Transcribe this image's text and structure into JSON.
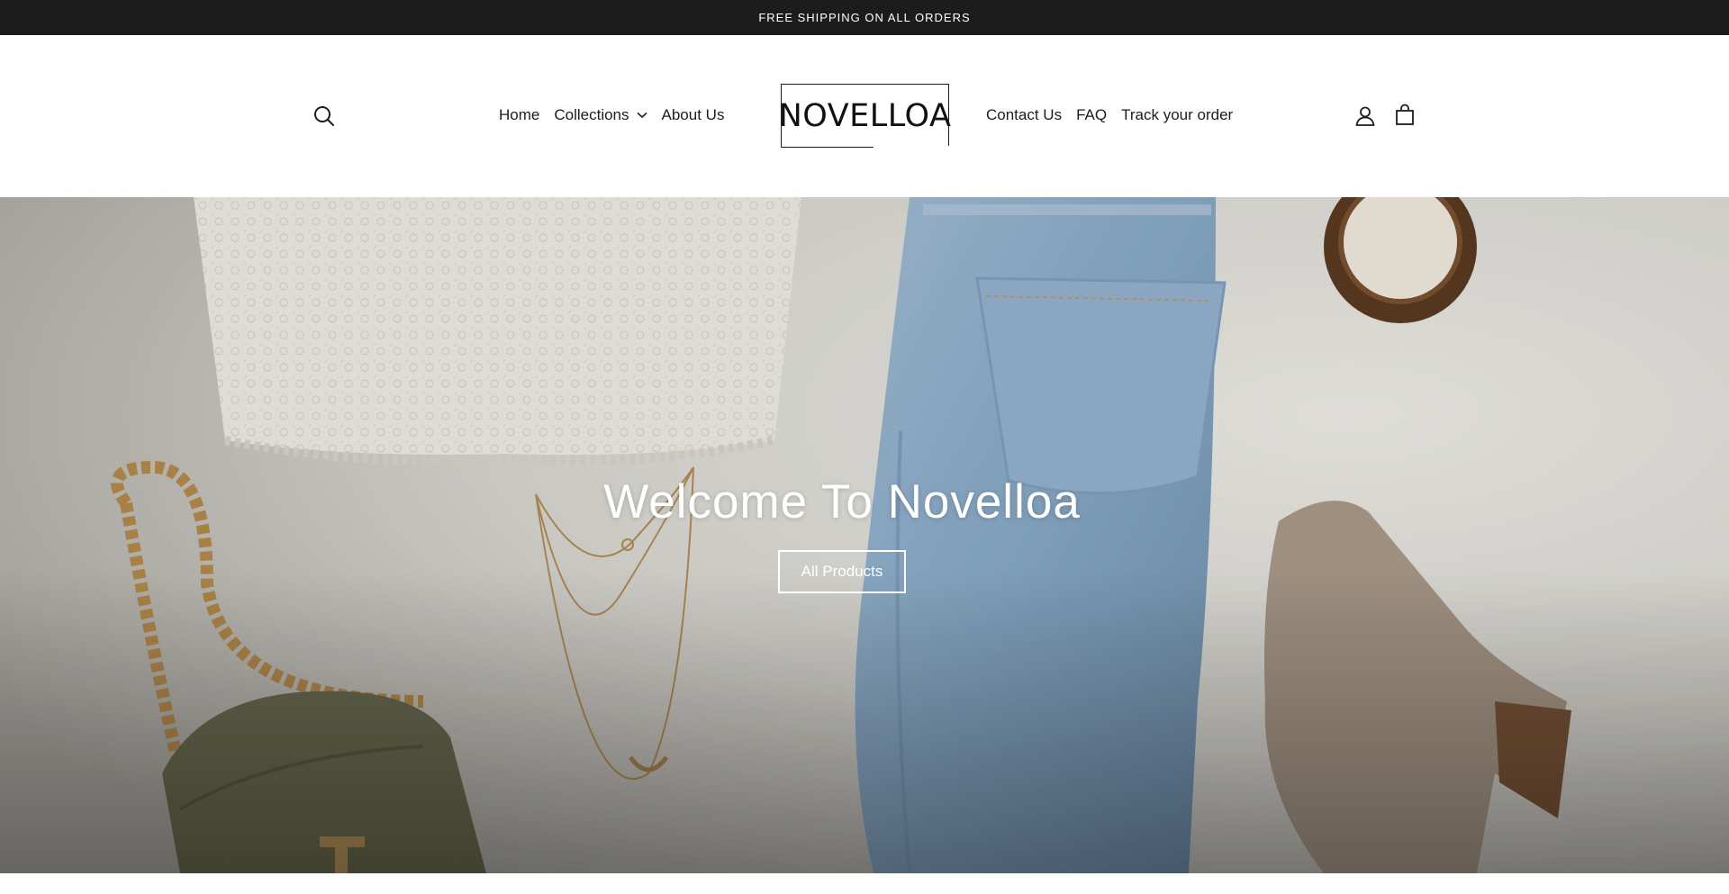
{
  "announcement": {
    "text": "FREE SHIPPING ON ALL ORDERS"
  },
  "header": {
    "logo_text": "NOVELLOA",
    "nav_left": [
      {
        "label": "Home"
      },
      {
        "label": "Collections"
      },
      {
        "label": "About Us"
      }
    ],
    "nav_right": [
      {
        "label": "Contact Us"
      },
      {
        "label": "FAQ"
      },
      {
        "label": "Track your order"
      }
    ],
    "icons": {
      "search": "search-icon",
      "collections_dropdown": "chevron-down-icon",
      "account": "user-icon",
      "cart": "shopping-bag-icon"
    }
  },
  "hero": {
    "title": "Welcome To Novelloa",
    "button_label": "All Products"
  },
  "colors": {
    "announcement_bg": "#1c1c1c",
    "text": "#1c1c1c",
    "hero_text": "#ffffff"
  }
}
